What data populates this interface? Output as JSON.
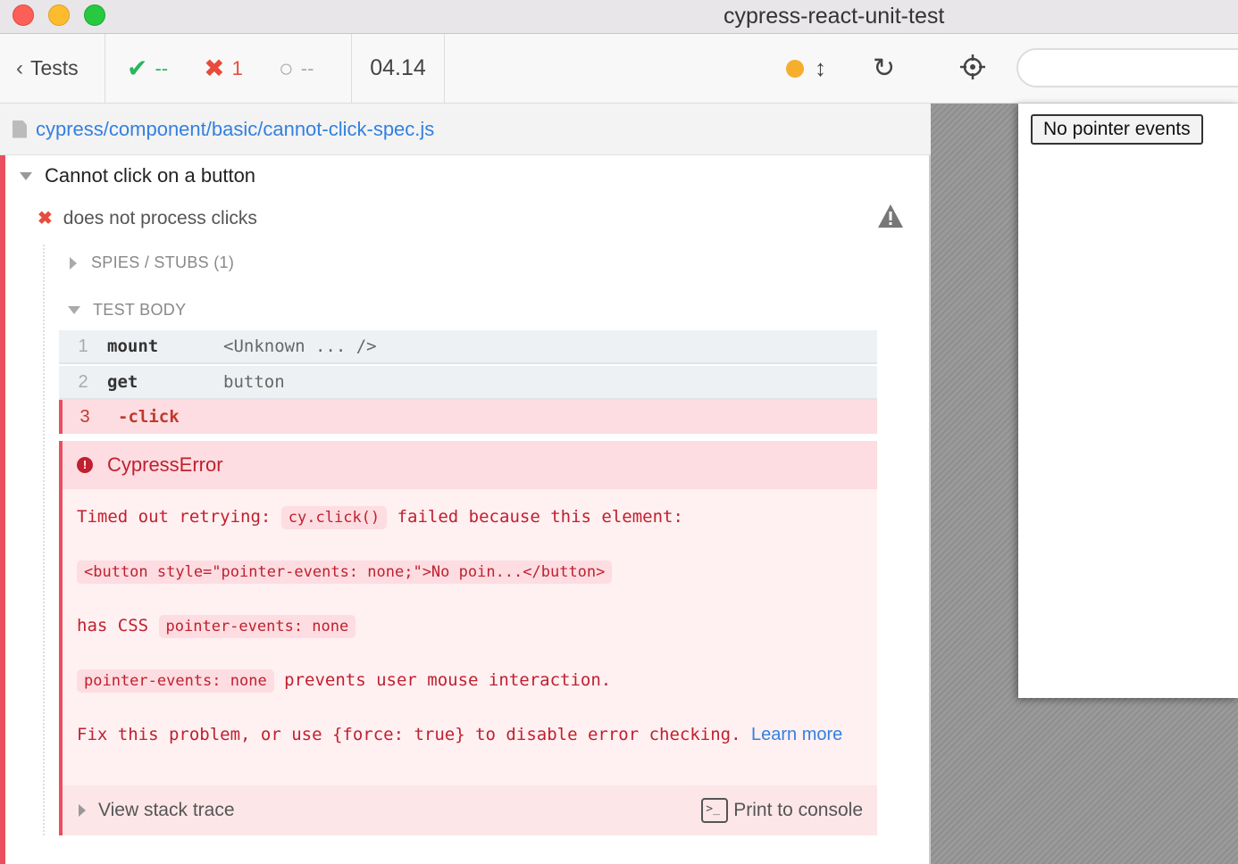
{
  "window": {
    "title": "cypress-react-unit-test"
  },
  "header": {
    "tests_label": "Tests",
    "stats": {
      "passed": "--",
      "failed": "1",
      "pending": "--"
    },
    "duration": "04.14"
  },
  "spec": {
    "path": "cypress/component/basic/cannot-click-spec.js"
  },
  "suite": {
    "title": "Cannot click on a button"
  },
  "test": {
    "title": "does not process clicks"
  },
  "sections": {
    "spies": "SPIES / STUBS (1)",
    "body": "TEST BODY"
  },
  "commands": [
    {
      "num": "1",
      "name": "mount",
      "message": "<Unknown ... />"
    },
    {
      "num": "2",
      "name": "get",
      "message": "button"
    },
    {
      "num": "3",
      "name": "-click",
      "message": ""
    }
  ],
  "error": {
    "name": "CypressError",
    "line1_pre": "Timed out retrying:",
    "line1_code": "cy.click()",
    "line1_post": "failed because this element:",
    "line2_code": "<button style=\"pointer-events: none;\">No poin...</button>",
    "line3_pre": "has CSS",
    "line3_code": "pointer-events: none",
    "line4_code": "pointer-events: none",
    "line4_post": "prevents user mouse interaction.",
    "line5_text": "Fix this problem, or use {force: true} to disable error checking.",
    "learn_more": "Learn more",
    "stack_trace": "View stack trace",
    "print_console": "Print to console"
  },
  "aut": {
    "url_value": "",
    "button_label": "No pointer events"
  },
  "colors": {
    "fail": "#e94f5f",
    "pass": "#2ab75e",
    "link": "#3380e0",
    "running": "#f6ae2d"
  },
  "icons": [
    "chevron-left-icon",
    "check-icon",
    "x-icon",
    "spinner-icon",
    "dot-icon",
    "scroll-arrows-icon",
    "reload-icon",
    "selector-crosshair-icon",
    "file-icon",
    "warning-icon",
    "error-icon",
    "terminal-icon"
  ]
}
